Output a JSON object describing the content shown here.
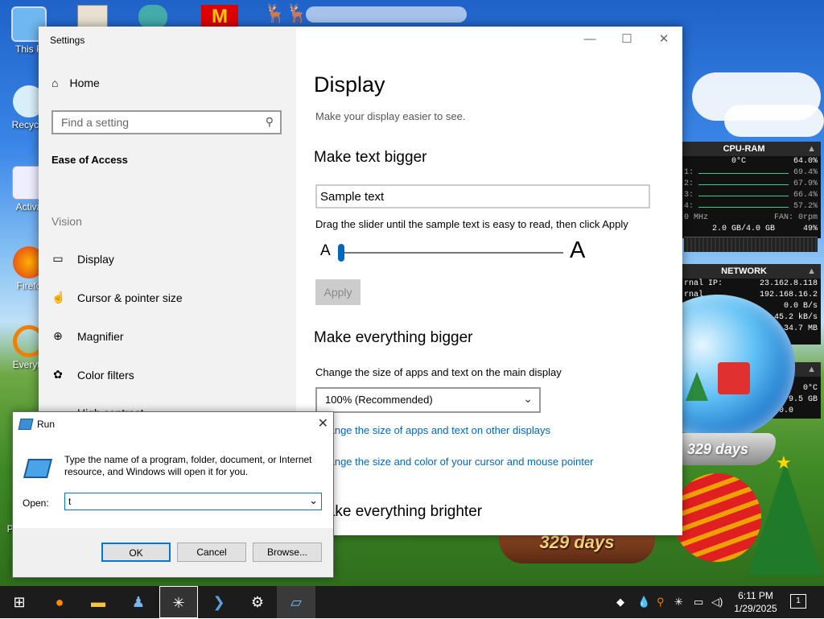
{
  "desktop": {
    "icons": [
      {
        "label": "This P"
      },
      {
        "label": "Recycle"
      },
      {
        "label": "Activa"
      },
      {
        "label": "Firefo"
      },
      {
        "label": "Everyth"
      },
      {
        "label": "Pa"
      }
    ]
  },
  "settings": {
    "window_title": "Settings",
    "controls": {
      "minimize": "—",
      "maximize": "☐",
      "close": "✕"
    },
    "home_label": "Home",
    "search_placeholder": "Find a setting",
    "section": "Ease of Access",
    "group": "Vision",
    "nav": [
      {
        "label": "Display",
        "icon": "monitor-icon"
      },
      {
        "label": "Cursor & pointer size",
        "icon": "cursor-icon"
      },
      {
        "label": "Magnifier",
        "icon": "magnifier-icon"
      },
      {
        "label": "Color filters",
        "icon": "color-filters-icon"
      },
      {
        "label": "High contrast",
        "icon": "contrast-icon"
      }
    ],
    "page_title": "Display",
    "page_subtitle": "Make your display easier to see.",
    "text_bigger": {
      "heading": "Make text bigger",
      "sample": "Sample text",
      "instructions": "Drag the slider until the sample text is easy to read, then click Apply",
      "small_a": "A",
      "big_a": "A",
      "slider_value": 0,
      "apply_label": "Apply"
    },
    "everything_bigger": {
      "heading": "Make everything bigger",
      "description": "Change the size of apps and text on the main display",
      "selected": "100% (Recommended)",
      "link1": "Change the size of apps and text on other displays",
      "link2": "Change the size and color of your cursor and mouse pointer"
    },
    "brighter_heading": "Make everything brighter"
  },
  "run": {
    "title": "Run",
    "description": "Type the name of a program, folder, document, or Internet resource, and Windows will open it for you.",
    "open_label": "Open:",
    "open_value": "t",
    "ok_label": "OK",
    "cancel_label": "Cancel",
    "browse_label": "Browse..."
  },
  "cpu_gadget": {
    "title": "CPU-RAM",
    "temp": "0°C",
    "total": "64.0%",
    "cores": [
      {
        "label": "1:",
        "value": "69.4%"
      },
      {
        "label": "2:",
        "value": "67.9%"
      },
      {
        "label": "3:",
        "value": "66.4%"
      },
      {
        "label": "4:",
        "value": "57.2%"
      }
    ],
    "freq": "0 MHz",
    "fan": "FAN: 0rpm",
    "ram": "2.0 GB/4.0 GB",
    "ram_pct": "49%"
  },
  "net_gadget": {
    "title": "NETWORK",
    "rows": [
      {
        "label": "rnal IP:",
        "value": "23.162.8.118"
      },
      {
        "label": "rnal",
        "value": "192.168.16.2"
      },
      {
        "label": "",
        "value": "0.0 B/s"
      },
      {
        "label": "",
        "value": "45.2 kB/s"
      },
      {
        "label": "",
        "value": "34.7 MB"
      }
    ]
  },
  "partial_gadget": {
    "temp": "0°C",
    "size": "9.5 GB",
    "val": "0.0"
  },
  "globes": {
    "big": "329 days",
    "small": "329 days"
  },
  "taskbar": {
    "time": "6:11 PM",
    "date": "1/29/2025",
    "notification_count": "1"
  }
}
